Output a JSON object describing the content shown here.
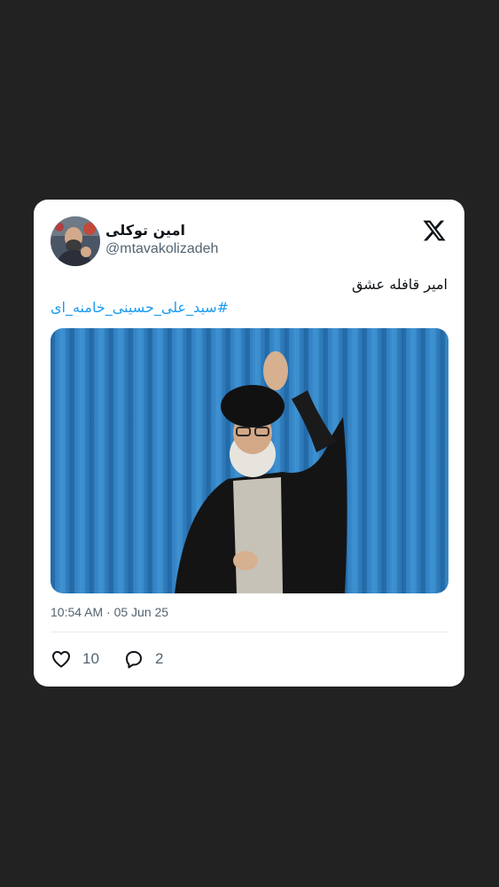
{
  "tweet": {
    "author": {
      "display_name": "امین توکلی",
      "handle": "@mtavakolizadeh"
    },
    "text": "امیر قافله عشق",
    "hashtag": "#سید_علی_حسینی_خامنه_ای",
    "timestamp": "10:54 AM · 05 Jun 25",
    "likes": "10",
    "replies": "2"
  },
  "icons": {
    "brand": "x-logo-icon",
    "like": "heart-icon",
    "reply": "reply-bubble-icon"
  },
  "colors": {
    "background": "#222222",
    "card": "#ffffff",
    "hashtag": "#1d9bf0",
    "secondary_text": "#536471",
    "photo_curtain": "#2f7fc0"
  }
}
